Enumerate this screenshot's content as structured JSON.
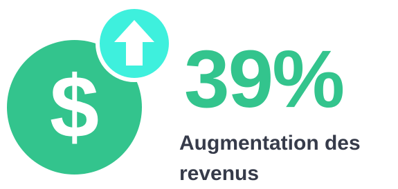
{
  "icon": {
    "main": "dollar-icon",
    "badge": "arrow-up-icon",
    "symbol": "$"
  },
  "stat": {
    "value": "39%",
    "caption": "Augmentation des revenus"
  },
  "colors": {
    "green": "#33c48d",
    "cyan": "#3ef0dd",
    "text": "#363b4a",
    "background": "#ffffff"
  }
}
